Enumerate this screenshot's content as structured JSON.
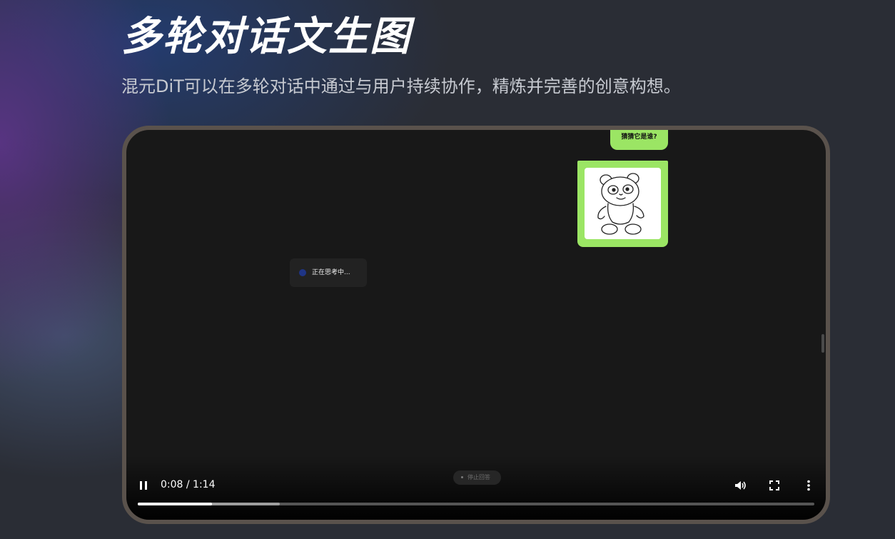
{
  "section": {
    "title": "多轮对话文生图",
    "subtitle": "混元DiT可以在多轮对话中通过与用户持续协作，精炼并完善的创意构想。"
  },
  "chat": {
    "user_message": "猜猜它是谁?",
    "image_subject": "panda line drawing",
    "status_text": "正在思考中...",
    "stop_button_label": "停止回答"
  },
  "player": {
    "state": "playing",
    "time_display": "0:08 / 1:14",
    "current_time": "0:08",
    "duration": "1:14",
    "progress_fraction": 0.11,
    "buffered_fraction": 0.21,
    "icons": {
      "pause": "pause-icon",
      "volume": "volume-icon",
      "fullscreen": "fullscreen-icon",
      "more": "more-options-icon"
    }
  },
  "colors": {
    "user_bubble": "#9be564",
    "thinking_dot": "#1f3586",
    "device_frame": "#5a524c",
    "screen_background": "#181818"
  }
}
